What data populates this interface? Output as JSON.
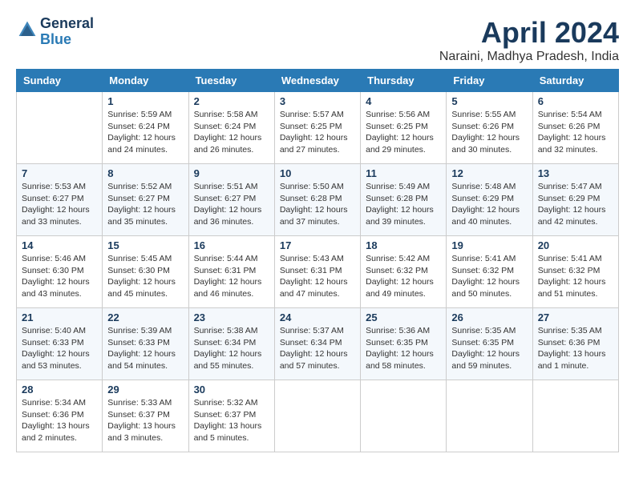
{
  "header": {
    "logo_line1": "General",
    "logo_line2": "Blue",
    "month_title": "April 2024",
    "location": "Naraini, Madhya Pradesh, India"
  },
  "weekdays": [
    "Sunday",
    "Monday",
    "Tuesday",
    "Wednesday",
    "Thursday",
    "Friday",
    "Saturday"
  ],
  "weeks": [
    [
      {
        "day": "",
        "sunrise": "",
        "sunset": "",
        "daylight": ""
      },
      {
        "day": "1",
        "sunrise": "Sunrise: 5:59 AM",
        "sunset": "Sunset: 6:24 PM",
        "daylight": "Daylight: 12 hours and 24 minutes."
      },
      {
        "day": "2",
        "sunrise": "Sunrise: 5:58 AM",
        "sunset": "Sunset: 6:24 PM",
        "daylight": "Daylight: 12 hours and 26 minutes."
      },
      {
        "day": "3",
        "sunrise": "Sunrise: 5:57 AM",
        "sunset": "Sunset: 6:25 PM",
        "daylight": "Daylight: 12 hours and 27 minutes."
      },
      {
        "day": "4",
        "sunrise": "Sunrise: 5:56 AM",
        "sunset": "Sunset: 6:25 PM",
        "daylight": "Daylight: 12 hours and 29 minutes."
      },
      {
        "day": "5",
        "sunrise": "Sunrise: 5:55 AM",
        "sunset": "Sunset: 6:26 PM",
        "daylight": "Daylight: 12 hours and 30 minutes."
      },
      {
        "day": "6",
        "sunrise": "Sunrise: 5:54 AM",
        "sunset": "Sunset: 6:26 PM",
        "daylight": "Daylight: 12 hours and 32 minutes."
      }
    ],
    [
      {
        "day": "7",
        "sunrise": "Sunrise: 5:53 AM",
        "sunset": "Sunset: 6:27 PM",
        "daylight": "Daylight: 12 hours and 33 minutes."
      },
      {
        "day": "8",
        "sunrise": "Sunrise: 5:52 AM",
        "sunset": "Sunset: 6:27 PM",
        "daylight": "Daylight: 12 hours and 35 minutes."
      },
      {
        "day": "9",
        "sunrise": "Sunrise: 5:51 AM",
        "sunset": "Sunset: 6:27 PM",
        "daylight": "Daylight: 12 hours and 36 minutes."
      },
      {
        "day": "10",
        "sunrise": "Sunrise: 5:50 AM",
        "sunset": "Sunset: 6:28 PM",
        "daylight": "Daylight: 12 hours and 37 minutes."
      },
      {
        "day": "11",
        "sunrise": "Sunrise: 5:49 AM",
        "sunset": "Sunset: 6:28 PM",
        "daylight": "Daylight: 12 hours and 39 minutes."
      },
      {
        "day": "12",
        "sunrise": "Sunrise: 5:48 AM",
        "sunset": "Sunset: 6:29 PM",
        "daylight": "Daylight: 12 hours and 40 minutes."
      },
      {
        "day": "13",
        "sunrise": "Sunrise: 5:47 AM",
        "sunset": "Sunset: 6:29 PM",
        "daylight": "Daylight: 12 hours and 42 minutes."
      }
    ],
    [
      {
        "day": "14",
        "sunrise": "Sunrise: 5:46 AM",
        "sunset": "Sunset: 6:30 PM",
        "daylight": "Daylight: 12 hours and 43 minutes."
      },
      {
        "day": "15",
        "sunrise": "Sunrise: 5:45 AM",
        "sunset": "Sunset: 6:30 PM",
        "daylight": "Daylight: 12 hours and 45 minutes."
      },
      {
        "day": "16",
        "sunrise": "Sunrise: 5:44 AM",
        "sunset": "Sunset: 6:31 PM",
        "daylight": "Daylight: 12 hours and 46 minutes."
      },
      {
        "day": "17",
        "sunrise": "Sunrise: 5:43 AM",
        "sunset": "Sunset: 6:31 PM",
        "daylight": "Daylight: 12 hours and 47 minutes."
      },
      {
        "day": "18",
        "sunrise": "Sunrise: 5:42 AM",
        "sunset": "Sunset: 6:32 PM",
        "daylight": "Daylight: 12 hours and 49 minutes."
      },
      {
        "day": "19",
        "sunrise": "Sunrise: 5:41 AM",
        "sunset": "Sunset: 6:32 PM",
        "daylight": "Daylight: 12 hours and 50 minutes."
      },
      {
        "day": "20",
        "sunrise": "Sunrise: 5:41 AM",
        "sunset": "Sunset: 6:32 PM",
        "daylight": "Daylight: 12 hours and 51 minutes."
      }
    ],
    [
      {
        "day": "21",
        "sunrise": "Sunrise: 5:40 AM",
        "sunset": "Sunset: 6:33 PM",
        "daylight": "Daylight: 12 hours and 53 minutes."
      },
      {
        "day": "22",
        "sunrise": "Sunrise: 5:39 AM",
        "sunset": "Sunset: 6:33 PM",
        "daylight": "Daylight: 12 hours and 54 minutes."
      },
      {
        "day": "23",
        "sunrise": "Sunrise: 5:38 AM",
        "sunset": "Sunset: 6:34 PM",
        "daylight": "Daylight: 12 hours and 55 minutes."
      },
      {
        "day": "24",
        "sunrise": "Sunrise: 5:37 AM",
        "sunset": "Sunset: 6:34 PM",
        "daylight": "Daylight: 12 hours and 57 minutes."
      },
      {
        "day": "25",
        "sunrise": "Sunrise: 5:36 AM",
        "sunset": "Sunset: 6:35 PM",
        "daylight": "Daylight: 12 hours and 58 minutes."
      },
      {
        "day": "26",
        "sunrise": "Sunrise: 5:35 AM",
        "sunset": "Sunset: 6:35 PM",
        "daylight": "Daylight: 12 hours and 59 minutes."
      },
      {
        "day": "27",
        "sunrise": "Sunrise: 5:35 AM",
        "sunset": "Sunset: 6:36 PM",
        "daylight": "Daylight: 13 hours and 1 minute."
      }
    ],
    [
      {
        "day": "28",
        "sunrise": "Sunrise: 5:34 AM",
        "sunset": "Sunset: 6:36 PM",
        "daylight": "Daylight: 13 hours and 2 minutes."
      },
      {
        "day": "29",
        "sunrise": "Sunrise: 5:33 AM",
        "sunset": "Sunset: 6:37 PM",
        "daylight": "Daylight: 13 hours and 3 minutes."
      },
      {
        "day": "30",
        "sunrise": "Sunrise: 5:32 AM",
        "sunset": "Sunset: 6:37 PM",
        "daylight": "Daylight: 13 hours and 5 minutes."
      },
      {
        "day": "",
        "sunrise": "",
        "sunset": "",
        "daylight": ""
      },
      {
        "day": "",
        "sunrise": "",
        "sunset": "",
        "daylight": ""
      },
      {
        "day": "",
        "sunrise": "",
        "sunset": "",
        "daylight": ""
      },
      {
        "day": "",
        "sunrise": "",
        "sunset": "",
        "daylight": ""
      }
    ]
  ]
}
